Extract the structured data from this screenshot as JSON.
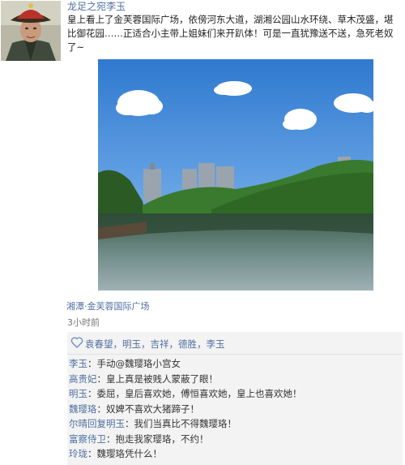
{
  "post": {
    "username": "龙足之宛李玉",
    "text": "皇上看上了金芙蓉国际广场，依傍河东大道，湖湘公园山水环绕、草木茂盛，堪比御花园……正适合小主带上姐妹们来开趴体！可是一直犹豫送不送，急死老奴了~",
    "location": "湘潭·金芙蓉国际广场",
    "time": "3小时前"
  },
  "likes": {
    "icon": "heart-icon",
    "names": [
      "袁春望",
      "明玉",
      "吉祥",
      "德胜",
      "李玉"
    ],
    "separator": "，"
  },
  "comments": [
    {
      "name": "李玉",
      "text": "：手动@魏璎珞小宫女"
    },
    {
      "name": "高贵妃",
      "text": "：皇上真是被贱人蒙蔽了眼！"
    },
    {
      "name": "明玉",
      "text": "：委屈，皇后喜欢她，傅恒喜欢她，皇上也喜欢她！"
    },
    {
      "name": "魏璎珞",
      "text": "：奴婢不喜欢大猪蹄子！"
    },
    {
      "name": "尔晴回复明玉",
      "text": "：我们当真比不得魏璎珞！"
    },
    {
      "name": "富察侍卫",
      "text": "：抱走我家璎珞，不约！"
    },
    {
      "name": "玲珑",
      "text": "：魏璎珞凭什么！"
    }
  ],
  "colors": {
    "link": "#4f6fa1",
    "panel": "#f3f3f3",
    "sky": "#3f86d6",
    "water": "#2f4a3a",
    "trees": "#2f6e2a"
  }
}
